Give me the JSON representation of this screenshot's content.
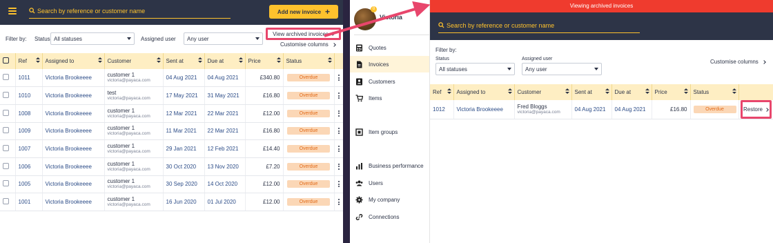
{
  "left": {
    "search_placeholder": "Search by reference or customer name",
    "add_button": "Add new invoice",
    "add_icon": "+",
    "filter_by": "Filter by:",
    "status_label": "Status",
    "status_value": "All statuses",
    "user_label": "Assigned user",
    "user_value": "Any user",
    "archived_link": "View archived invoices",
    "customise": "Customise columns",
    "columns": [
      "Ref",
      "Assigned to",
      "Customer",
      "Sent at",
      "Due at",
      "Price",
      "Status"
    ],
    "rows": [
      {
        "ref": "1011",
        "assigned": "Victoria Brookeeee",
        "customer": "customer 1",
        "email": "victoria@payaca.com",
        "sent": "04 Aug 2021",
        "due": "04 Aug 2021",
        "price": "£340.80",
        "status": "Overdue"
      },
      {
        "ref": "1010",
        "assigned": "Victoria Brookeeee",
        "customer": "test",
        "email": "victoria@payaca.com",
        "sent": "17 May 2021",
        "due": "31 May 2021",
        "price": "£16.80",
        "status": "Overdue"
      },
      {
        "ref": "1008",
        "assigned": "Victoria Brookeeee",
        "customer": "customer 1",
        "email": "victoria@payaca.com",
        "sent": "12 Mar 2021",
        "due": "22 Mar 2021",
        "price": "£12.00",
        "status": "Overdue"
      },
      {
        "ref": "1009",
        "assigned": "Victoria Brookeeee",
        "customer": "customer 1",
        "email": "victoria@payaca.com",
        "sent": "11 Mar 2021",
        "due": "22 Mar 2021",
        "price": "£16.80",
        "status": "Overdue"
      },
      {
        "ref": "1007",
        "assigned": "Victoria Brookeeee",
        "customer": "customer 1",
        "email": "victoria@payaca.com",
        "sent": "29 Jan 2021",
        "due": "12 Feb 2021",
        "price": "£14.40",
        "status": "Overdue"
      },
      {
        "ref": "1006",
        "assigned": "Victoria Brookeeee",
        "customer": "customer 1",
        "email": "victoria@payaca.com",
        "sent": "30 Oct 2020",
        "due": "13 Nov 2020",
        "price": "£7.20",
        "status": "Overdue"
      },
      {
        "ref": "1005",
        "assigned": "Victoria Brookeeee",
        "customer": "customer 1",
        "email": "victoria@payaca.com",
        "sent": "30 Sep 2020",
        "due": "14 Oct 2020",
        "price": "£12.00",
        "status": "Overdue"
      },
      {
        "ref": "1001",
        "assigned": "Victoria Brookeeee",
        "customer": "customer 1",
        "email": "victoria@payaca.com",
        "sent": "16 Jun 2020",
        "due": "01 Jul 2020",
        "price": "£12.00",
        "status": "Overdue"
      }
    ]
  },
  "sidebar": {
    "org_name": "Victoria",
    "avatar_badge": "0",
    "items": [
      {
        "label": "Quotes",
        "icon": "calculator-icon"
      },
      {
        "label": "Invoices",
        "icon": "document-icon"
      },
      {
        "label": "Customers",
        "icon": "contact-card-icon"
      },
      {
        "label": "Items",
        "icon": "cart-icon"
      },
      {
        "label": "Item groups",
        "icon": "item-groups-icon"
      },
      {
        "label": "Business performance",
        "icon": "bar-chart-icon"
      },
      {
        "label": "Users",
        "icon": "users-icon"
      },
      {
        "label": "My company",
        "icon": "gear-icon"
      },
      {
        "label": "Connections",
        "icon": "link-icon"
      }
    ]
  },
  "right": {
    "banner": "Viewing archived invoices",
    "search_placeholder": "Search by reference or customer name",
    "filter_by": "Filter by:",
    "status_label": "Status",
    "status_value": "All statuses",
    "user_label": "Assigned user",
    "user_value": "Any user",
    "customise": "Customise columns",
    "columns": [
      "Ref",
      "Assigned to",
      "Customer",
      "Sent at",
      "Due at",
      "Price",
      "Status"
    ],
    "row": {
      "ref": "1012",
      "assigned": "Victoria Brookeeee",
      "customer": "Fred Bloggs",
      "email": "victoria@payaca.com",
      "sent": "04 Aug 2021",
      "due": "04 Aug 2021",
      "price": "£16.80",
      "status": "Overdue",
      "action": "Restore"
    }
  },
  "colors": {
    "navy": "#2d3447",
    "yellow": "#fec22d",
    "banner_red": "#ef3b2e",
    "highlight_pink": "#e8466c",
    "overdue_bg": "#fbd7b6",
    "overdue_text": "#e26b19",
    "header_bg": "#feeec3"
  }
}
